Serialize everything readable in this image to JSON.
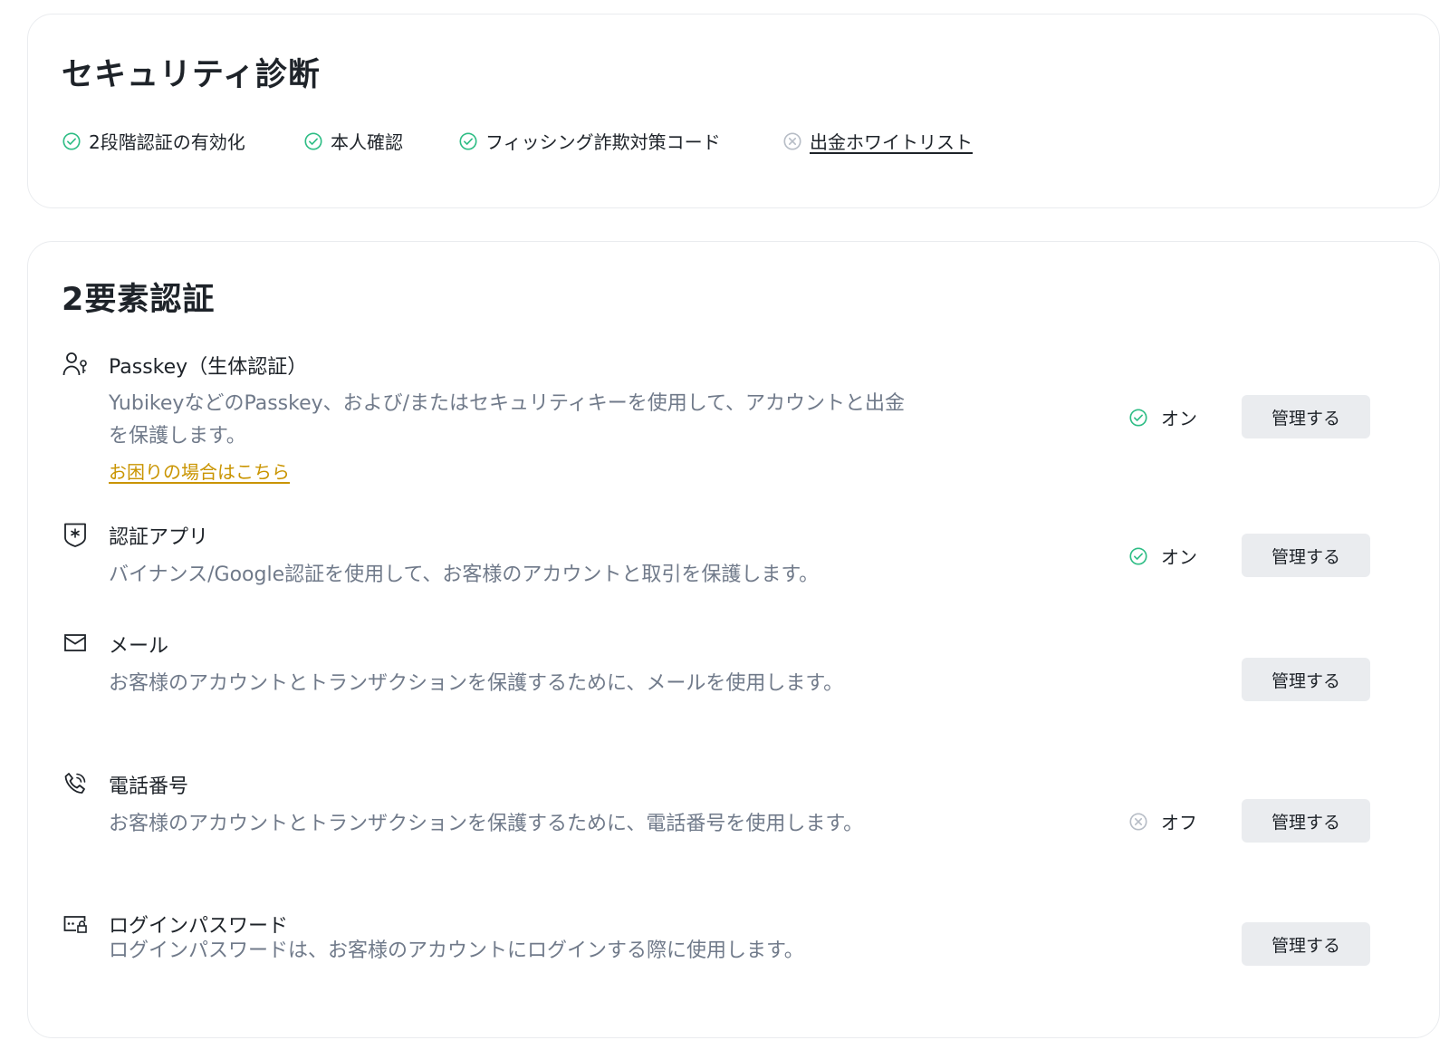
{
  "diagnosis": {
    "title": "セキュリティ診断",
    "items": [
      {
        "label": "2段階認証の有効化",
        "status": "done"
      },
      {
        "label": "本人確認",
        "status": "done"
      },
      {
        "label": "フィッシング詐欺対策コード",
        "status": "done"
      },
      {
        "label": "出金ホワイトリスト",
        "status": "not-done"
      }
    ]
  },
  "two_factor": {
    "title": "2要素認証",
    "methods": [
      {
        "icon": "passkey-user-icon",
        "title": "Passkey（生体認証）",
        "description": "YubikeyなどのPasskey、および/またはセキュリティキーを使用して、アカウントと出金を保護します。",
        "help_link": "お困りの場合はこちら",
        "status": "オン",
        "button": "管理する"
      },
      {
        "icon": "authenticator-shield-icon",
        "title": "認証アプリ",
        "description": "バイナンス/Google認証を使用して、お客様のアカウントと取引を保護します。",
        "status": "オン",
        "button": "管理する"
      },
      {
        "icon": "mail-icon",
        "title": "メール",
        "description": "お客様のアカウントとトランザクションを保護するために、メールを使用します。",
        "button": "管理する"
      },
      {
        "icon": "phone-icon",
        "title": "電話番号",
        "description": "お客様のアカウントとトランザクションを保護するために、電話番号を使用します。",
        "status": "オフ",
        "button": "管理する"
      },
      {
        "icon": "password-lock-icon",
        "title": "ログインパスワード",
        "description": "ログインパスワードは、お客様のアカウントにログインする際に使用します。",
        "button": "管理する"
      }
    ]
  },
  "colors": {
    "check_green": "#2ebd85",
    "muted_gray": "#b7bdc6",
    "link_gold": "#c99400",
    "button_bg": "#eaecef",
    "desc_gray": "#707a8a"
  }
}
